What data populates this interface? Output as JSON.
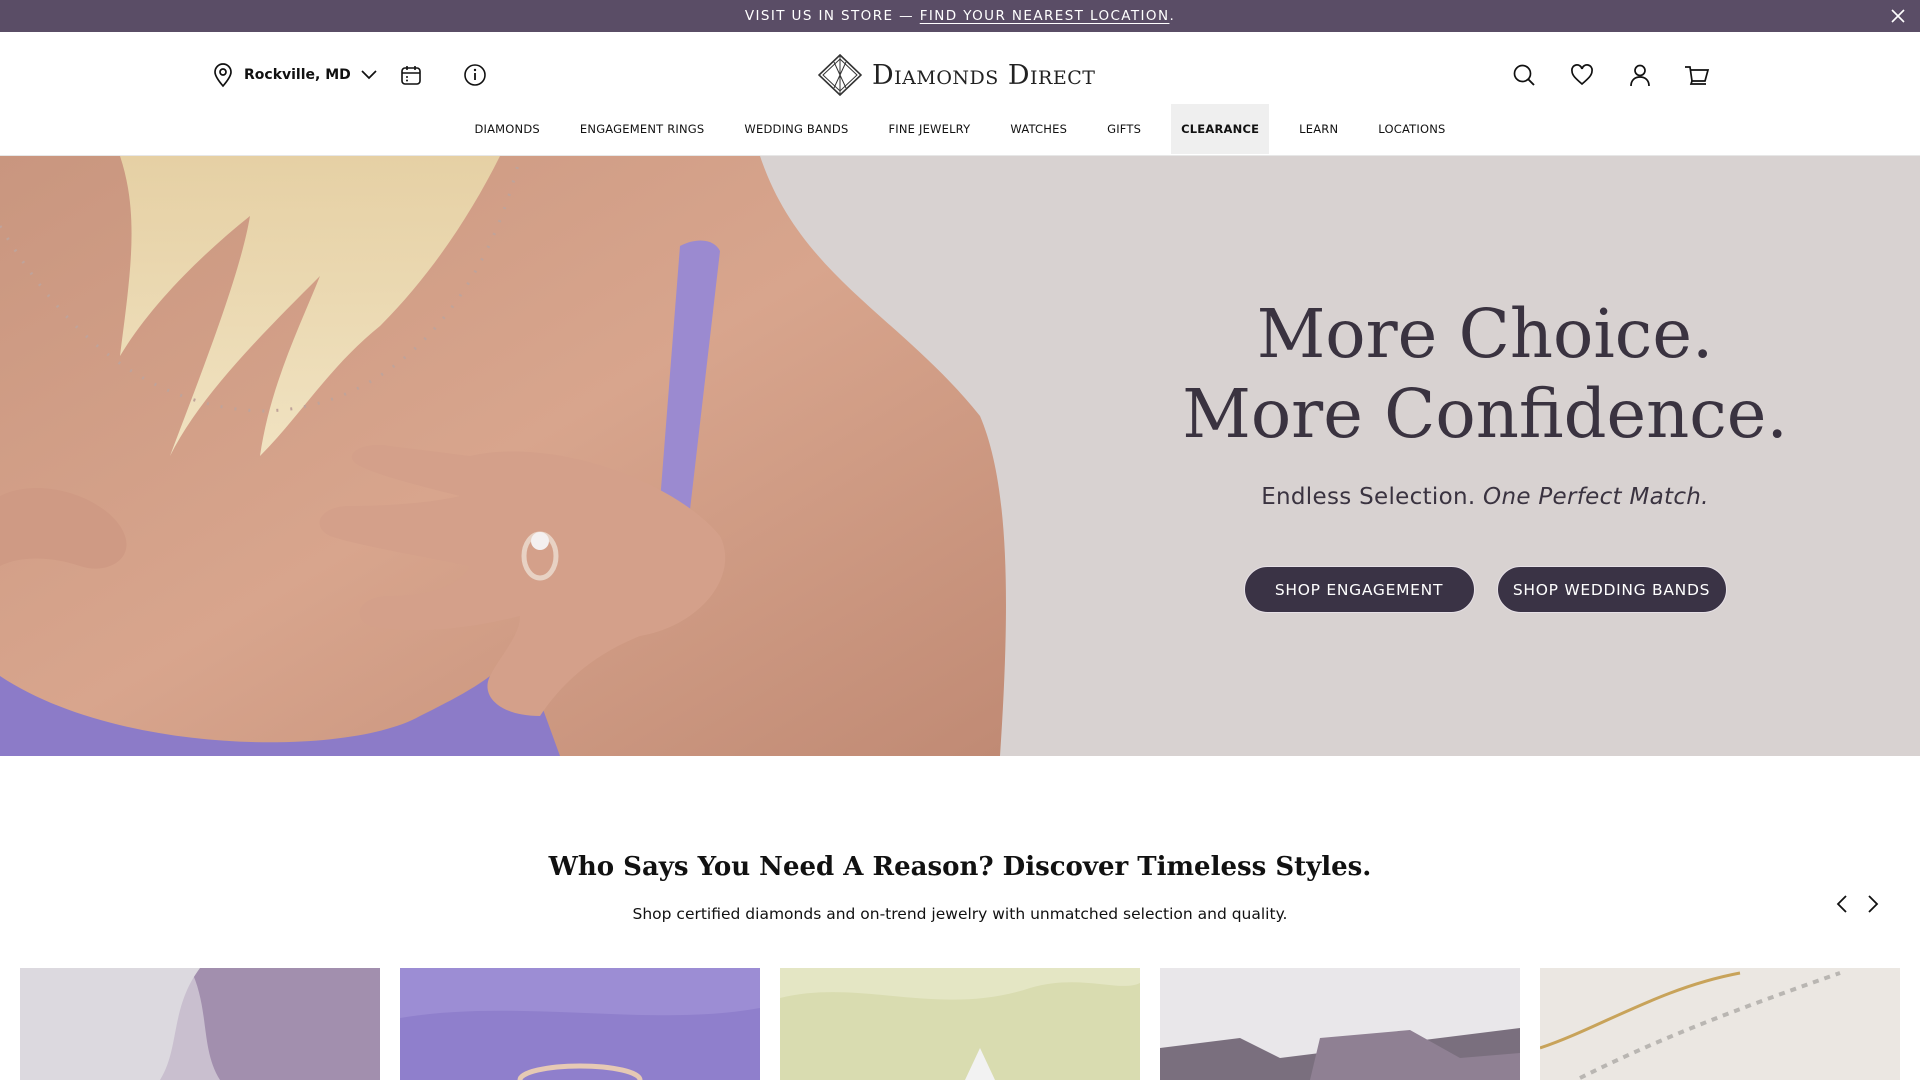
{
  "announcement": {
    "prefix": "VISIT US IN STORE — ",
    "link": "FIND YOUR NEAREST LOCATION",
    "suffix": "."
  },
  "header": {
    "location": "Rockville, MD",
    "brand": "Diamonds Direct",
    "nav": [
      "DIAMONDS",
      "ENGAGEMENT RINGS",
      "WEDDING BANDS",
      "FINE JEWELRY",
      "WATCHES",
      "GIFTS",
      "CLEARANCE",
      "LEARN",
      "LOCATIONS"
    ],
    "active_nav": "CLEARANCE"
  },
  "hero": {
    "title": "More Choice. More Confidence.",
    "subtitle_plain": "Endless Selection. ",
    "subtitle_italic": "One Perfect Match.",
    "btn_engagement": "SHOP ENGAGEMENT",
    "btn_bands": "SHOP WEDDING BANDS"
  },
  "section": {
    "title": "Who Says You Need A Reason? Discover Timeless Styles.",
    "subtitle": "Shop certified diamonds and on-trend jewelry with unmatched selection and quality."
  },
  "colors": {
    "announcement_bg": "#5a4d66",
    "button_bg": "#3a3345",
    "hero_bg": "#d8d2d1"
  }
}
